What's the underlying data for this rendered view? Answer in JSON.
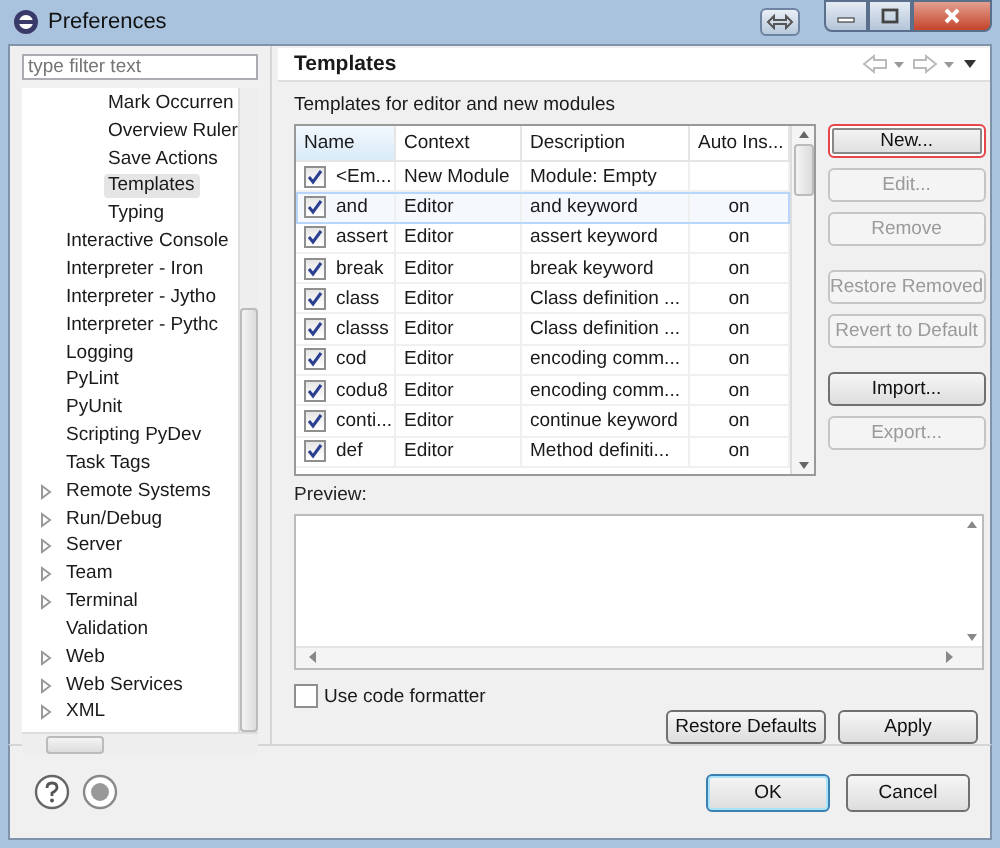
{
  "window": {
    "title": "Preferences"
  },
  "filter": {
    "placeholder": "type filter text"
  },
  "tree": [
    {
      "children": [
        {
          "children": [
            {
              "label": "Mark Occurren",
              "selected": false
            },
            {
              "label": "Overview Ruler",
              "selected": false
            },
            {
              "label": "Save Actions",
              "selected": false
            },
            {
              "label": "Templates",
              "selected": true
            },
            {
              "label": "Typing",
              "selected": false
            }
          ]
        },
        {
          "label": "Interactive Console",
          "expandable": false
        },
        {
          "label": "Interpreter - Iron",
          "expandable": false
        },
        {
          "label": "Interpreter - Jytho",
          "expandable": false
        },
        {
          "label": "Interpreter - Pythc",
          "expandable": false
        },
        {
          "label": "Logging",
          "expandable": false
        },
        {
          "label": "PyLint",
          "expandable": false
        },
        {
          "label": "PyUnit",
          "expandable": false
        },
        {
          "label": "Scripting PyDev",
          "expandable": false
        },
        {
          "label": "Task Tags",
          "expandable": false
        }
      ]
    },
    {
      "label": "Remote Systems",
      "expandable": true
    },
    {
      "label": "Run/Debug",
      "expandable": true
    },
    {
      "label": "Server",
      "expandable": true
    },
    {
      "label": "Team",
      "expandable": true
    },
    {
      "label": "Terminal",
      "expandable": true
    },
    {
      "label": "Validation",
      "expandable": false
    },
    {
      "label": "Web",
      "expandable": true
    },
    {
      "label": "Web Services",
      "expandable": true
    },
    {
      "label": "XML",
      "expandable": true
    }
  ],
  "page": {
    "title": "Templates",
    "subtitle": "Templates for editor and new modules"
  },
  "table": {
    "columns": [
      "Name",
      "Context",
      "Description",
      "Auto Ins..."
    ],
    "rows": [
      {
        "checked": true,
        "selected": false,
        "cells": [
          "<Em...",
          "New Module",
          "Module: Empty",
          ""
        ]
      },
      {
        "checked": true,
        "selected": true,
        "cells": [
          "and",
          "Editor",
          "and keyword",
          "on"
        ]
      },
      {
        "checked": true,
        "selected": false,
        "cells": [
          "assert",
          "Editor",
          "assert keyword",
          "on"
        ]
      },
      {
        "checked": true,
        "selected": false,
        "cells": [
          "break",
          "Editor",
          "break keyword",
          "on"
        ]
      },
      {
        "checked": true,
        "selected": false,
        "cells": [
          "class",
          "Editor",
          "Class definition ...",
          "on"
        ]
      },
      {
        "checked": true,
        "selected": false,
        "cells": [
          "classs",
          "Editor",
          "Class definition ...",
          "on"
        ]
      },
      {
        "checked": true,
        "selected": false,
        "cells": [
          "cod",
          "Editor",
          "encoding comm...",
          "on"
        ]
      },
      {
        "checked": true,
        "selected": false,
        "cells": [
          "codu8",
          "Editor",
          "encoding comm...",
          "on"
        ]
      },
      {
        "checked": true,
        "selected": false,
        "cells": [
          "conti...",
          "Editor",
          "continue keyword",
          "on"
        ]
      },
      {
        "checked": true,
        "selected": false,
        "cells": [
          "def",
          "Editor",
          "Method definiti...",
          "on"
        ]
      }
    ]
  },
  "side_button_groups": [
    [
      {
        "label": "New...",
        "disabled": false,
        "highlighted": true
      },
      {
        "label": "Edit...",
        "disabled": true,
        "highlighted": false
      },
      {
        "label": "Remove",
        "disabled": true,
        "highlighted": false
      }
    ],
    [
      {
        "label": "Restore Removed",
        "disabled": true,
        "highlighted": false
      },
      {
        "label": "Revert to Default",
        "disabled": true,
        "highlighted": false
      }
    ],
    [
      {
        "label": "Import...",
        "disabled": false,
        "highlighted": false
      },
      {
        "label": "Export...",
        "disabled": true,
        "highlighted": false
      }
    ]
  ],
  "preview": {
    "label": "Preview:"
  },
  "formatter": {
    "label": "Use code formatter",
    "checked": false
  },
  "page_buttons": [
    "Restore Defaults",
    "Apply"
  ],
  "dialog_buttons": [
    {
      "label": "OK",
      "default": true
    },
    {
      "label": "Cancel",
      "default": false
    }
  ]
}
